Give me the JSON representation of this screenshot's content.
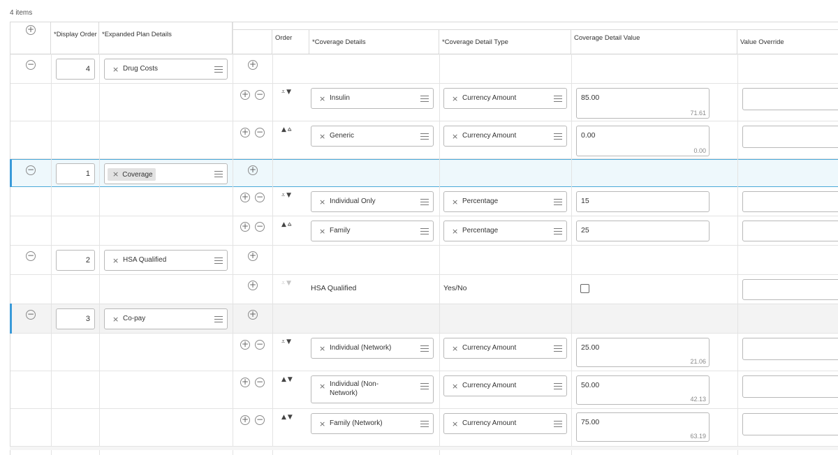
{
  "items_count": "4 items",
  "headers": {
    "display_order": "*Display Order",
    "expanded_plan_details": "*Expanded Plan Details",
    "order": "Order",
    "coverage_details": "*Coverage Details",
    "coverage_detail_type": "*Coverage Detail Type",
    "coverage_detail_value": "Coverage Detail Value",
    "value_override": "Value Override"
  },
  "plans": [
    {
      "display_order": "4",
      "detail": "Drug Costs",
      "coverage": [
        {
          "detail": "Insulin",
          "type": "Currency Amount",
          "value": "85.00",
          "sub": "71.61",
          "arrows": "down"
        },
        {
          "detail": "Generic",
          "type": "Currency Amount",
          "value": "0.00",
          "sub": "0.00",
          "arrows": "up"
        }
      ]
    },
    {
      "display_order": "1",
      "detail": "Coverage",
      "coverage": [
        {
          "detail": "Individual Only",
          "type": "Percentage",
          "value": "15",
          "sub": "",
          "arrows": "down"
        },
        {
          "detail": "Family",
          "type": "Percentage",
          "value": "25",
          "sub": "",
          "arrows": "up"
        }
      ]
    },
    {
      "display_order": "2",
      "detail": "HSA Qualified",
      "coverage": [
        {
          "detail": "HSA Qualified",
          "type": "Yes/No",
          "value": "",
          "sub": "",
          "arrows": "down-muted"
        }
      ]
    },
    {
      "display_order": "3",
      "detail": "Co-pay",
      "coverage": [
        {
          "detail": "Individual (Network)",
          "type": "Currency Amount",
          "value": "25.00",
          "sub": "21.06",
          "arrows": "down"
        },
        {
          "detail": "Individual (Non-\nNetwork)",
          "type": "Currency Amount",
          "value": "50.00",
          "sub": "42.13",
          "arrows": "updown"
        },
        {
          "detail": "Family (Network)",
          "type": "Currency Amount",
          "value": "75.00",
          "sub": "63.19",
          "arrows": "updown"
        }
      ]
    }
  ]
}
